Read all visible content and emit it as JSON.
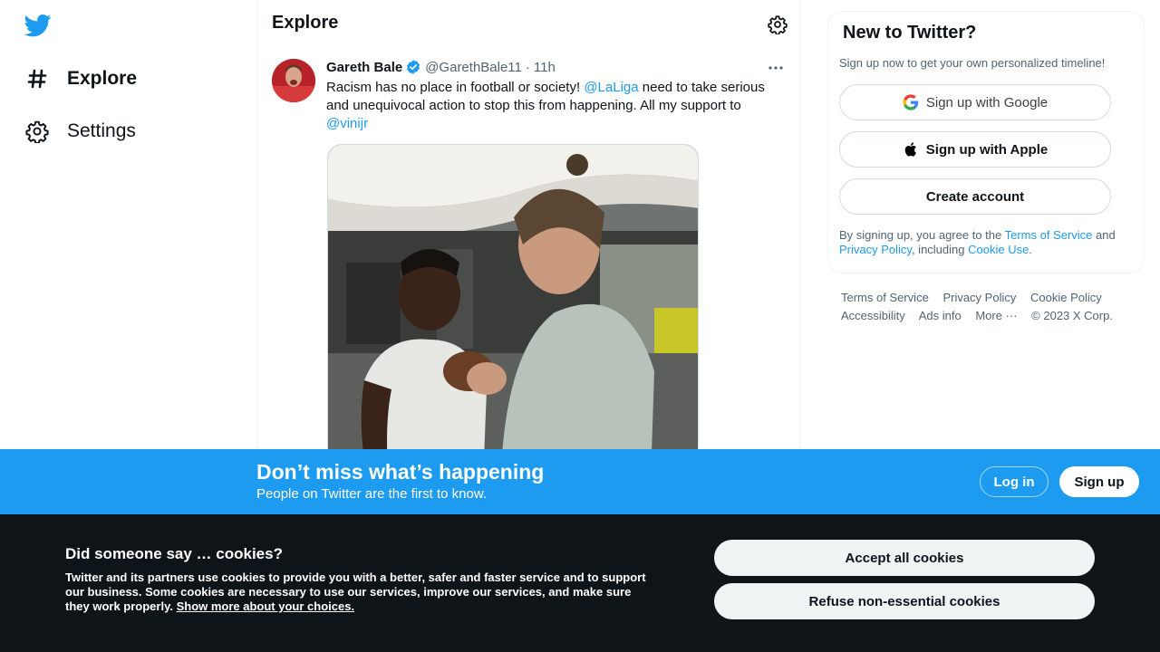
{
  "nav": {
    "items": [
      {
        "label": "Explore",
        "icon": "hashtag-icon"
      },
      {
        "label": "Settings",
        "icon": "gear-icon"
      }
    ]
  },
  "main": {
    "title": "Explore"
  },
  "tweet": {
    "author_name": "Gareth Bale",
    "handle": "@GarethBale11",
    "dot": "·",
    "time": "11h",
    "text_1": "Racism has no place in football or society! ",
    "mention_1": "@LaLiga",
    "text_2": " need to take serious and unequivocal action to stop this from happening. All my support to ",
    "mention_2": "@vinijr"
  },
  "signup_card": {
    "title": "New to Twitter?",
    "subtitle": "Sign up now to get your own personalized timeline!",
    "google_label": "Sign up with Google",
    "apple_label": "Sign up with Apple",
    "create_label": "Create account",
    "legal_1": "By signing up, you agree to the ",
    "terms_link": "Terms of Service",
    "legal_2": " and ",
    "privacy_link": "Privacy Policy",
    "legal_3": ", including ",
    "cookie_link": "Cookie Use",
    "legal_4": "."
  },
  "footer": {
    "terms": "Terms of Service",
    "privacy": "Privacy Policy",
    "cookie": "Cookie Policy",
    "accessibility": "Accessibility",
    "ads": "Ads info",
    "more": "More ···",
    "copyright": "© 2023 X Corp."
  },
  "banner": {
    "title": "Don’t miss what’s happening",
    "subtitle": "People on Twitter are the first to know.",
    "login_label": "Log in",
    "signup_label": "Sign up"
  },
  "cookie": {
    "title": "Did someone say … cookies?",
    "text": "Twitter and its partners use cookies to provide you with a better, safer and faster service and to support our business. Some cookies are necessary to use our services, improve our services, and make sure they work properly. ",
    "link": "Show more about your choices.",
    "accept_label": "Accept all cookies",
    "refuse_label": "Refuse non-essential cookies"
  },
  "colors": {
    "brand_blue": "#1d9bf0",
    "text_primary": "#0f1419",
    "text_secondary": "#536471",
    "cookie_bg": "#0f1419"
  }
}
